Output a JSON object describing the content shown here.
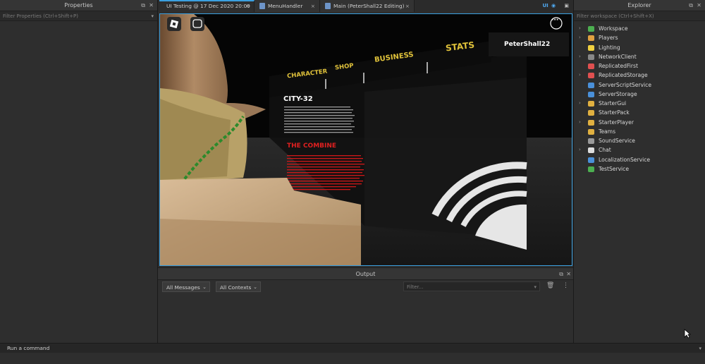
{
  "properties": {
    "title": "Properties",
    "filter_placeholder": "Filter Properties (Ctrl+Shift+P)"
  },
  "tabs": [
    {
      "label": "UI Testing @ 17 Dec 2020 20:09",
      "close": "×"
    },
    {
      "label": "MenuHandler",
      "close": "×"
    },
    {
      "label": "Main (PeterShall22 Editing)",
      "close": "×"
    }
  ],
  "tabs_right": {
    "ui_label": "UI"
  },
  "game": {
    "menu_items": [
      "CHARACTER",
      "SHOP",
      "BUSINESS",
      "STATS"
    ],
    "username": "PeterShall22",
    "panel_title": "CITY-32",
    "faction_title": "THE COMBINE",
    "more_glyph": "···"
  },
  "output": {
    "title": "Output",
    "messages_dropdown": "All Messages",
    "contexts_dropdown": "All Contexts",
    "filter_placeholder": "Filter..."
  },
  "explorer": {
    "title": "Explorer",
    "filter_placeholder": "Filter workspace (Ctrl+Shift+X)",
    "items": [
      {
        "label": "Workspace",
        "expandable": true,
        "icon_color": "#4caf50"
      },
      {
        "label": "Players",
        "expandable": true,
        "icon_color": "#e0a040"
      },
      {
        "label": "Lighting",
        "expandable": false,
        "icon_color": "#f0d040"
      },
      {
        "label": "NetworkClient",
        "expandable": true,
        "icon_color": "#888888"
      },
      {
        "label": "ReplicatedFirst",
        "expandable": false,
        "icon_color": "#e05050"
      },
      {
        "label": "ReplicatedStorage",
        "expandable": true,
        "icon_color": "#e05050"
      },
      {
        "label": "ServerScriptService",
        "expandable": false,
        "icon_color": "#4a90d9"
      },
      {
        "label": "ServerStorage",
        "expandable": false,
        "icon_color": "#4a90d9"
      },
      {
        "label": "StarterGui",
        "expandable": true,
        "icon_color": "#e0b040"
      },
      {
        "label": "StarterPack",
        "expandable": false,
        "icon_color": "#e0b040"
      },
      {
        "label": "StarterPlayer",
        "expandable": true,
        "icon_color": "#e0b040"
      },
      {
        "label": "Teams",
        "expandable": false,
        "icon_color": "#e0b040"
      },
      {
        "label": "SoundService",
        "expandable": false,
        "icon_color": "#999999"
      },
      {
        "label": "Chat",
        "expandable": true,
        "icon_color": "#dddddd"
      },
      {
        "label": "LocalizationService",
        "expandable": false,
        "icon_color": "#4a90d9"
      },
      {
        "label": "TestService",
        "expandable": false,
        "icon_color": "#4caf50"
      }
    ]
  },
  "command_bar": {
    "placeholder": "Run a command"
  },
  "colors": {
    "accent": "#3ba0e0",
    "menu_gold": "#e0c23a",
    "faction_red": "#e02020"
  }
}
